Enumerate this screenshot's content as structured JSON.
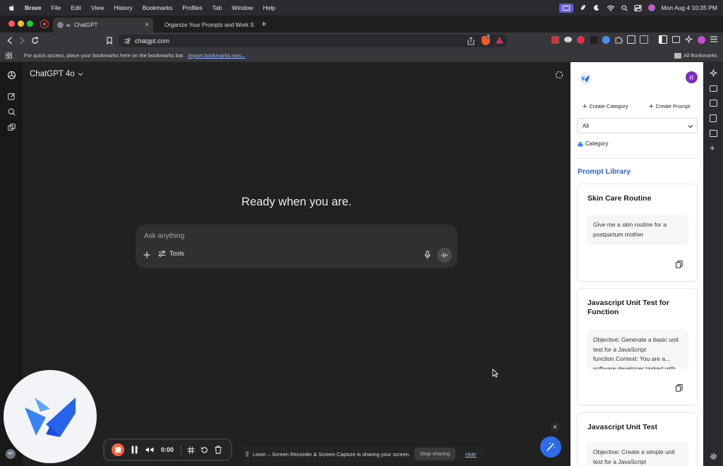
{
  "menubar": {
    "app": "Brave",
    "items": [
      "File",
      "Edit",
      "View",
      "History",
      "Bookmarks",
      "Profiles",
      "Tab",
      "Window",
      "Help"
    ],
    "datetime": "Mon Aug 4  10:35 PM"
  },
  "tabs": [
    {
      "label": "ChatGPT",
      "active": true
    },
    {
      "label": "Organize Your Prompts and Work S",
      "active": false
    }
  ],
  "address": {
    "url": "chatgpt.com",
    "shield_count": "2"
  },
  "bookmarks": {
    "notice": "For quick access, place your bookmarks here on the bookmarks bar.",
    "import_link": "Import bookmarks now...",
    "all_bookmarks": "All Bookmarks"
  },
  "chat": {
    "model_label": "ChatGPT 4o",
    "headline": "Ready when you are.",
    "input_placeholder": "Ask anything",
    "tools_label": "Tools"
  },
  "panel": {
    "avatar_letter": "R",
    "create_category": "Create Category",
    "create_prompt": "Create Prompt",
    "filter_value": "All",
    "category_label": "Category",
    "library_title": "Prompt Library",
    "cards": [
      {
        "title": "Skin Care Routine",
        "body": "Give me a skin routine for a postpartum mother"
      },
      {
        "title": "Javascript Unit Test for Function",
        "body": "Objective: Generate a basic unit test for a JavaScript function.Context: You are a... software developer tasked with"
      },
      {
        "title": "Javascript Unit Test",
        "body": "Objective: Create a simple unit test for a JavaScript"
      }
    ]
  },
  "loom": {
    "timer": "0:00",
    "sharing_text": "Loom – Screen Recorder & Screen Capture is sharing your screen.",
    "stop_label": "Stop sharing",
    "hide_label": "Hide",
    "mini_avatar": "AP"
  },
  "colors": {
    "accent_blue": "#2563eb",
    "avatar_purple": "#7b2cbf",
    "loom_red": "#ff623e"
  }
}
